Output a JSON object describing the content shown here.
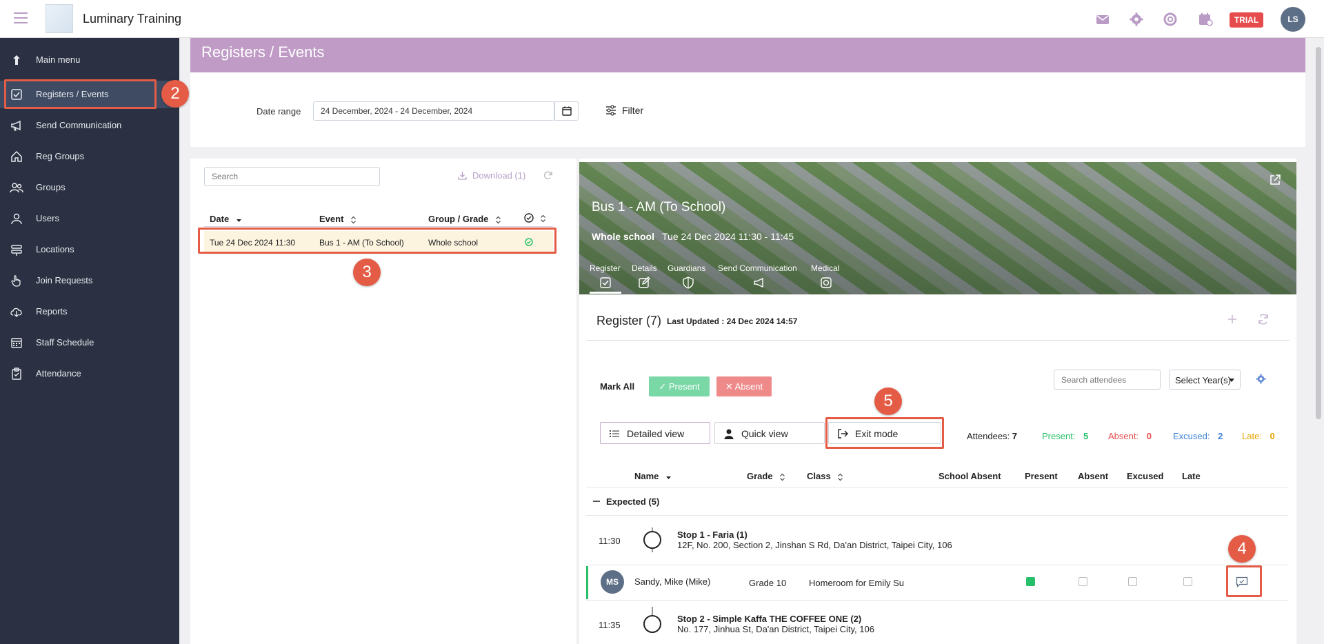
{
  "app": {
    "title": "Luminary Training",
    "trial": "TRIAL",
    "avatar": "LS"
  },
  "sidebar": {
    "items": [
      {
        "label": "Main menu",
        "icon": "arrow-up-icon"
      },
      {
        "label": "Registers / Events",
        "icon": "check-square-icon"
      },
      {
        "label": "Send Communication",
        "icon": "megaphone-icon"
      },
      {
        "label": "Reg Groups",
        "icon": "home-icon"
      },
      {
        "label": "Groups",
        "icon": "users-icon"
      },
      {
        "label": "Users",
        "icon": "user-icon"
      },
      {
        "label": "Locations",
        "icon": "locations-icon"
      },
      {
        "label": "Join Requests",
        "icon": "hand-icon"
      },
      {
        "label": "Reports",
        "icon": "cloud-download-icon"
      },
      {
        "label": "Staff Schedule",
        "icon": "calendar-icon"
      },
      {
        "label": "Attendance",
        "icon": "clipboard-icon"
      }
    ]
  },
  "page": {
    "title": "Registers / Events"
  },
  "filters": {
    "date_range_label": "Date range",
    "date_range_value": "24 December, 2024 - 24 December, 2024",
    "filter_label": "Filter"
  },
  "list": {
    "search_placeholder": "Search",
    "download_label": "Download (1)",
    "columns": {
      "date": "Date",
      "event": "Event",
      "group": "Group / Grade"
    },
    "rows": [
      {
        "date": "Tue 24 Dec 2024 11:30",
        "event": "Bus 1 - AM (To School)",
        "group": "Whole school"
      }
    ]
  },
  "event": {
    "title": "Bus 1 - AM (To School)",
    "group": "Whole school",
    "time": "Tue 24 Dec 2024 11:30 - 11:45",
    "tabs": [
      "Register",
      "Details",
      "Guardians",
      "Send Communication",
      "Medical"
    ]
  },
  "register": {
    "title": "Register (7)",
    "last_updated": "Last Updated : 24 Dec 2024 14:57",
    "mark_all": "Mark All",
    "present_btn": "Present",
    "absent_btn": "Absent",
    "search_placeholder": "Search attendees",
    "select_year": "Select Year(s)",
    "views": {
      "detailed": "Detailed view",
      "quick": "Quick view",
      "exit": "Exit mode"
    },
    "stats": {
      "attendees_label": "Attendees:",
      "attendees": "7",
      "present_label": "Present:",
      "present": "5",
      "absent_label": "Absent:",
      "absent": "0",
      "excused_label": "Excused:",
      "excused": "2",
      "late_label": "Late:",
      "late": "0"
    },
    "columns": {
      "name": "Name",
      "grade": "Grade",
      "class": "Class",
      "school_absent": "School Absent",
      "present": "Present",
      "absent": "Absent",
      "excused": "Excused",
      "late": "Late"
    },
    "expected_label": "Expected (5)",
    "stops": [
      {
        "time": "11:30",
        "name": "Stop 1 - Faria (1)",
        "address": "12F, No. 200, Section 2, Jinshan S Rd, Da'an District, Taipei City, 106"
      },
      {
        "time": "11:35",
        "name": "Stop 2 - Simple Kaffa THE COFFEE ONE (2)",
        "address": "No. 177, Jinhua St, Da'an District, Taipei City, 106"
      }
    ],
    "student": {
      "initials": "MS",
      "name": "Sandy, Mike (Mike)",
      "grade": "Grade 10",
      "class": "Homeroom for Emily Su",
      "present": true,
      "absent": false,
      "excused": false,
      "late": false
    }
  },
  "annotations": {
    "b2": "2",
    "b3": "3",
    "b4": "4",
    "b5": "5"
  },
  "colors": {
    "sidebar": "#2b3142",
    "header": "#bf9bc6",
    "present": "#26c06a",
    "absent": "#e74c4c",
    "excused": "#3b82d6",
    "late": "#e6a100",
    "annotation": "#e45c45"
  }
}
